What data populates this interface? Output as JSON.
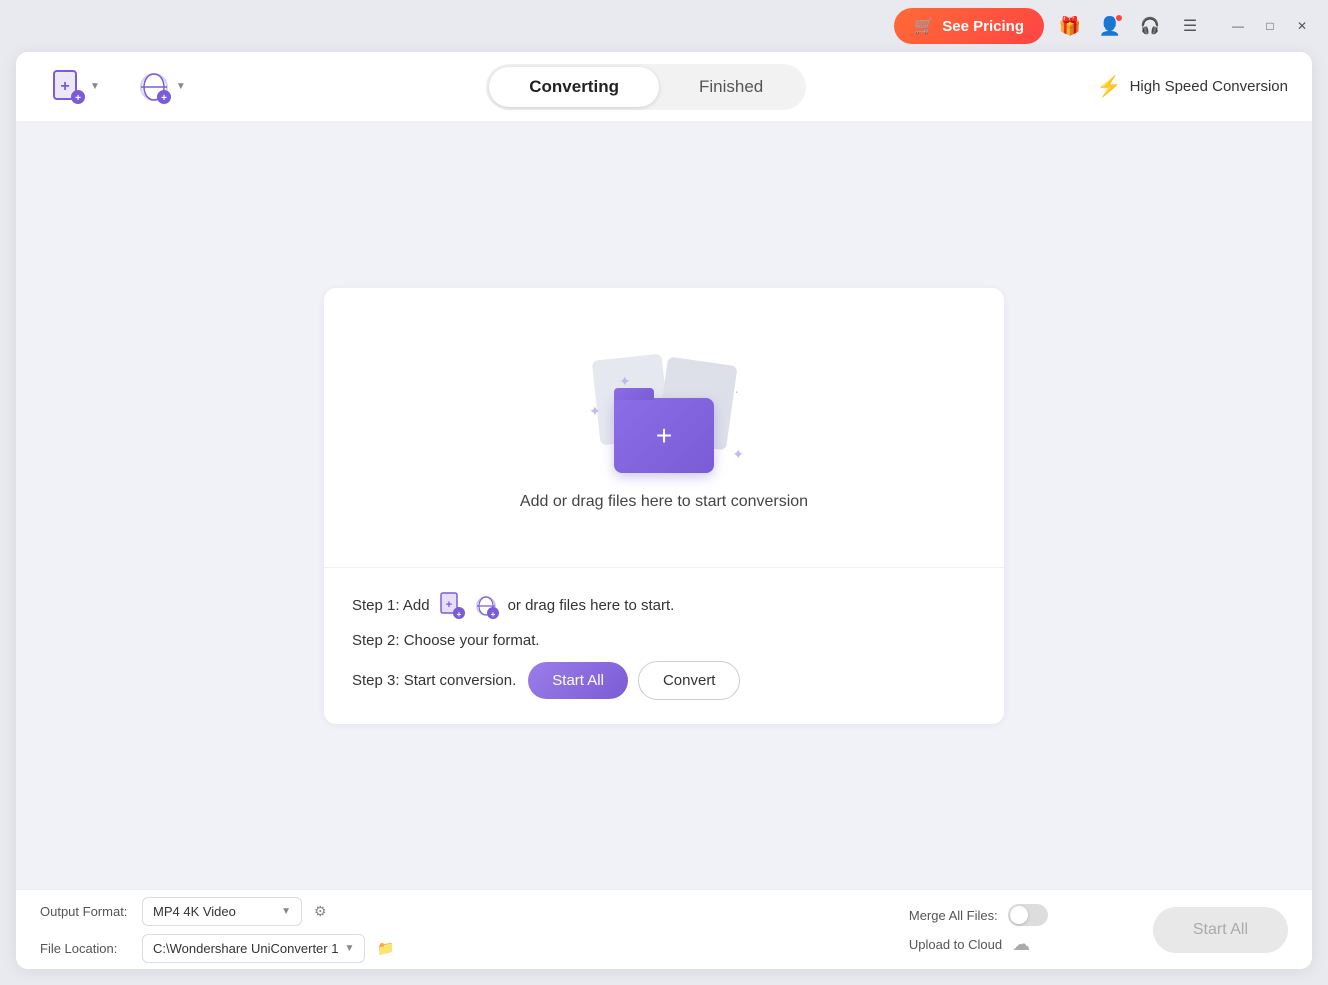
{
  "titlebar": {
    "see_pricing_label": "See Pricing",
    "cart_icon": "🛒",
    "gift_icon": "🎁",
    "menu_icon": "☰",
    "minimize_icon": "—",
    "maximize_icon": "□",
    "close_icon": "✕"
  },
  "header": {
    "tab_converting": "Converting",
    "tab_finished": "Finished",
    "high_speed_label": "High Speed Conversion",
    "bolt_icon": "⚡"
  },
  "drop_zone": {
    "drop_text": "Add or drag files here to start conversion",
    "plus_icon": "+"
  },
  "steps": {
    "step1_prefix": "Step 1: Add",
    "step1_suffix": "or drag files here to start.",
    "step2": "Step 2: Choose your format.",
    "step3_prefix": "Step 3: Start conversion.",
    "start_all_label": "Start All",
    "convert_label": "Convert"
  },
  "bottom_bar": {
    "output_format_label": "Output Format:",
    "output_format_value": "MP4 4K Video",
    "file_location_label": "File Location:",
    "file_location_value": "C:\\Wondershare UniConverter 1",
    "merge_files_label": "Merge All Files:",
    "upload_cloud_label": "Upload to Cloud",
    "start_all_label": "Start All"
  }
}
